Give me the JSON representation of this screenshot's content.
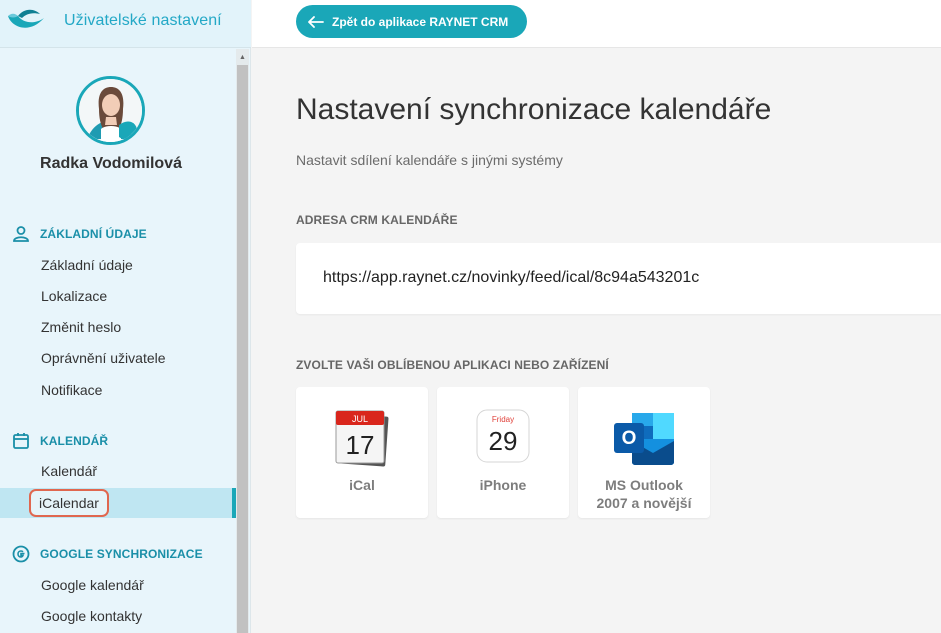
{
  "sidebar": {
    "title": "Uživatelské nastavení",
    "user_name": "Radka Vodomilová",
    "sections": [
      {
        "title": "ZÁKLADNÍ ÚDAJE",
        "icon": "person-icon",
        "items": [
          "Základní údaje",
          "Lokalizace",
          "Změnit heslo",
          "Oprávnění uživatele",
          "Notifikace"
        ]
      },
      {
        "title": "KALENDÁŘ",
        "icon": "calendar-icon",
        "items": [
          "Kalendář",
          "iCalendar"
        ]
      },
      {
        "title": "GOOGLE SYNCHRONIZACE",
        "icon": "google-icon",
        "items": [
          "Google kalendář",
          "Google kontakty"
        ]
      }
    ],
    "active_item": "iCalendar"
  },
  "topbar": {
    "back_label": "Zpět do aplikace RAYNET CRM"
  },
  "main": {
    "title": "Nastavení synchronizace kalendáře",
    "subtitle": "Nastavit sdílení kalendáře s jinými systémy",
    "crm_label": "ADRESA CRM KALENDÁŘE",
    "crm_url": "https://app.raynet.cz/novinky/feed/ical/8c94a543201c",
    "apps_label": "ZVOLTE VAŠI OBLÍBENOU APLIKACI NEBO ZAŘÍZENÍ",
    "apps": [
      {
        "name": "iCal",
        "icon": "ical-icon",
        "month": "JUL",
        "day": "17"
      },
      {
        "name": "iPhone",
        "icon": "iphone-calendar-icon",
        "weekday": "Friday",
        "day": "29"
      },
      {
        "name": "MS Outlook\n2007 a novější",
        "icon": "outlook-icon",
        "letter": "O"
      }
    ]
  },
  "colors": {
    "accent": "#1aa7b8",
    "sidebar_bg": "#e8f5fb",
    "highlight": "#e0674f"
  }
}
